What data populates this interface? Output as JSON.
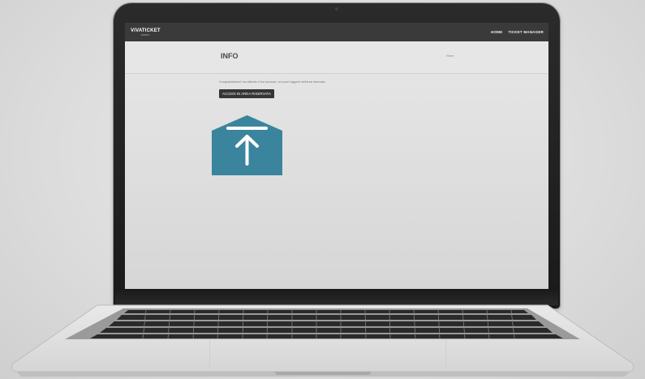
{
  "app": {
    "logo_text": "VIVATICKET",
    "logo_sub": "EVENTS"
  },
  "navbar": {
    "items": [
      {
        "label": "HOME"
      },
      {
        "label": "TICKET MANAGER"
      }
    ]
  },
  "header": {
    "title": "INFO",
    "breadcrumb": "Home"
  },
  "main": {
    "message": "Congratulazioni! hai attivato il tuo account, ora puoi loggarti nell'area riservata.",
    "button_label": "ACCEDI IN AREA RISERVATA"
  },
  "overlay": {
    "icon": "upload-icon",
    "color": "#3b849e"
  },
  "colors": {
    "navbar": "#3a3a3a",
    "button": "#353535",
    "page_bg": "#e1e1e1"
  }
}
